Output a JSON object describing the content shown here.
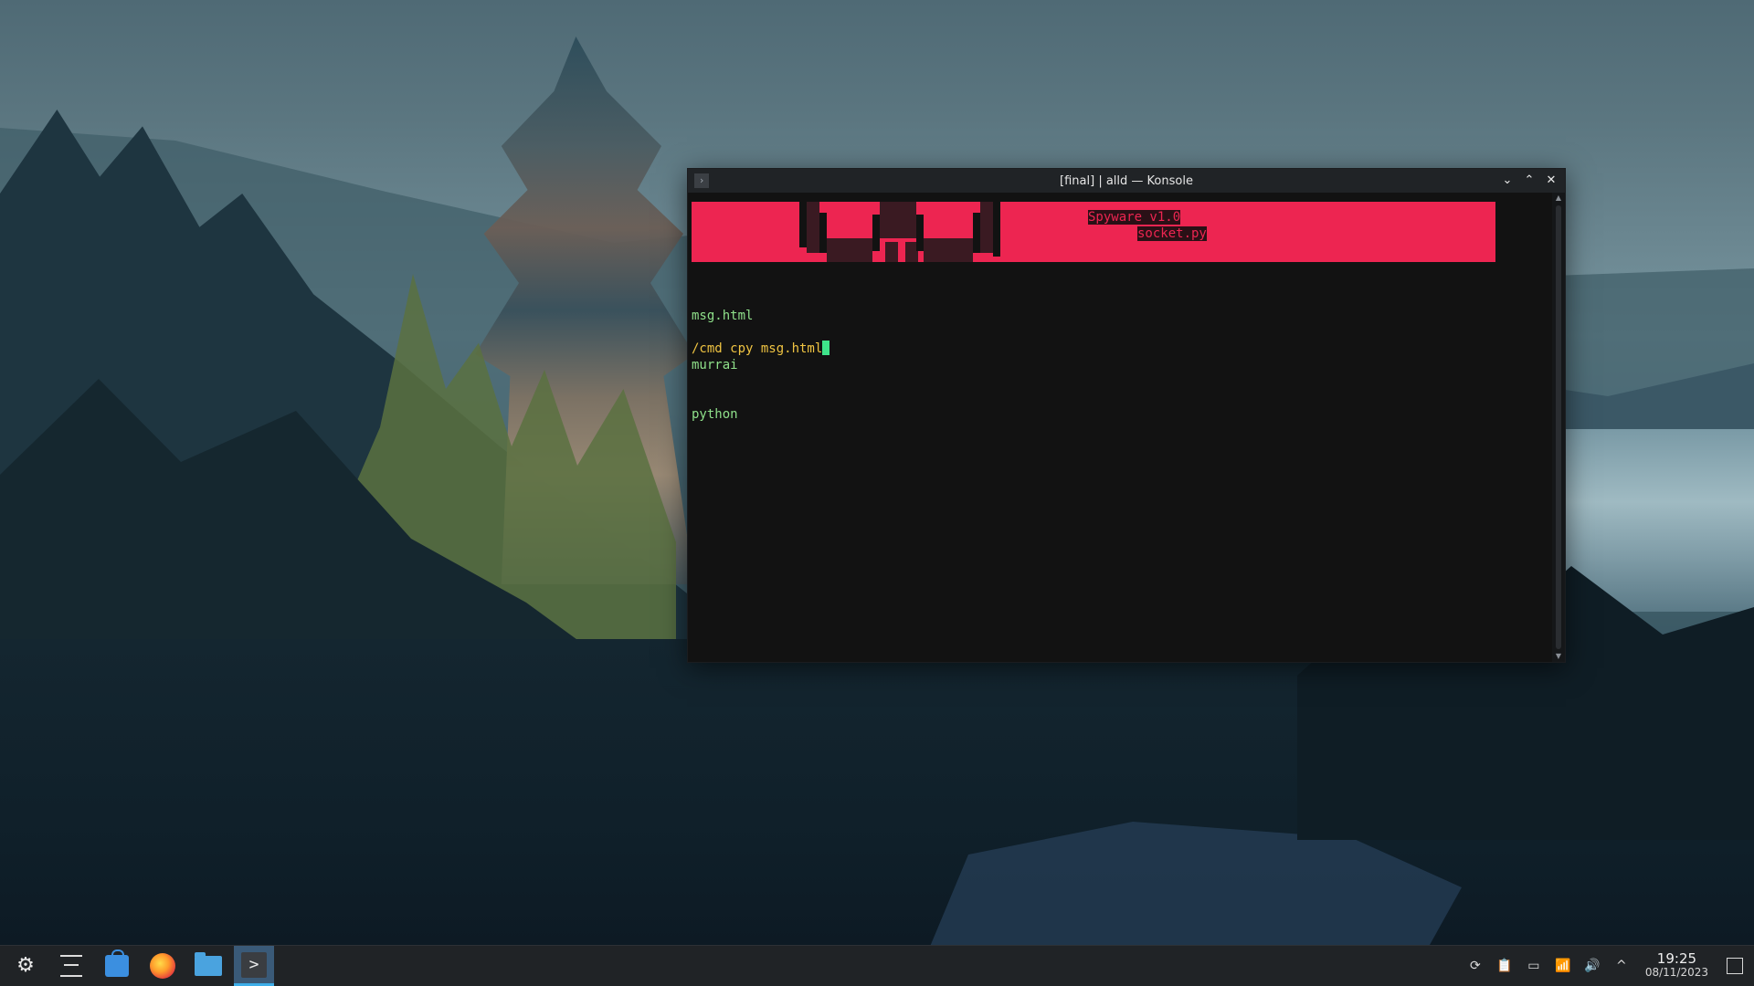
{
  "window": {
    "title": "[final] | alld — Konsole",
    "app_icon_glyph": "›",
    "buttons": {
      "minimize": "⌄",
      "maximize": "⌃",
      "close": "✕"
    }
  },
  "terminal": {
    "banner_line1": "Spyware v1.0",
    "banner_line2": "socket.py",
    "ls_lines": [
      "msg.html",
      "murrai",
      "python"
    ],
    "prompt": "/cmd cpy msg.html",
    "colors": {
      "banner": "#ed2551",
      "ls": "#8fe08a",
      "prompt": "#f0c442",
      "cursor": "#3ee38a",
      "background": "#121212"
    }
  },
  "taskbar": {
    "launcher_glyph": "⚙",
    "terminal_glyph": ">",
    "clock": {
      "time": "19:25",
      "date": "08/11/2023"
    },
    "tray_glyphs": {
      "update": "⟳",
      "clipboard": "📋",
      "battery": "▭",
      "network": "📶",
      "volume": "🔊",
      "expand": "^"
    }
  }
}
